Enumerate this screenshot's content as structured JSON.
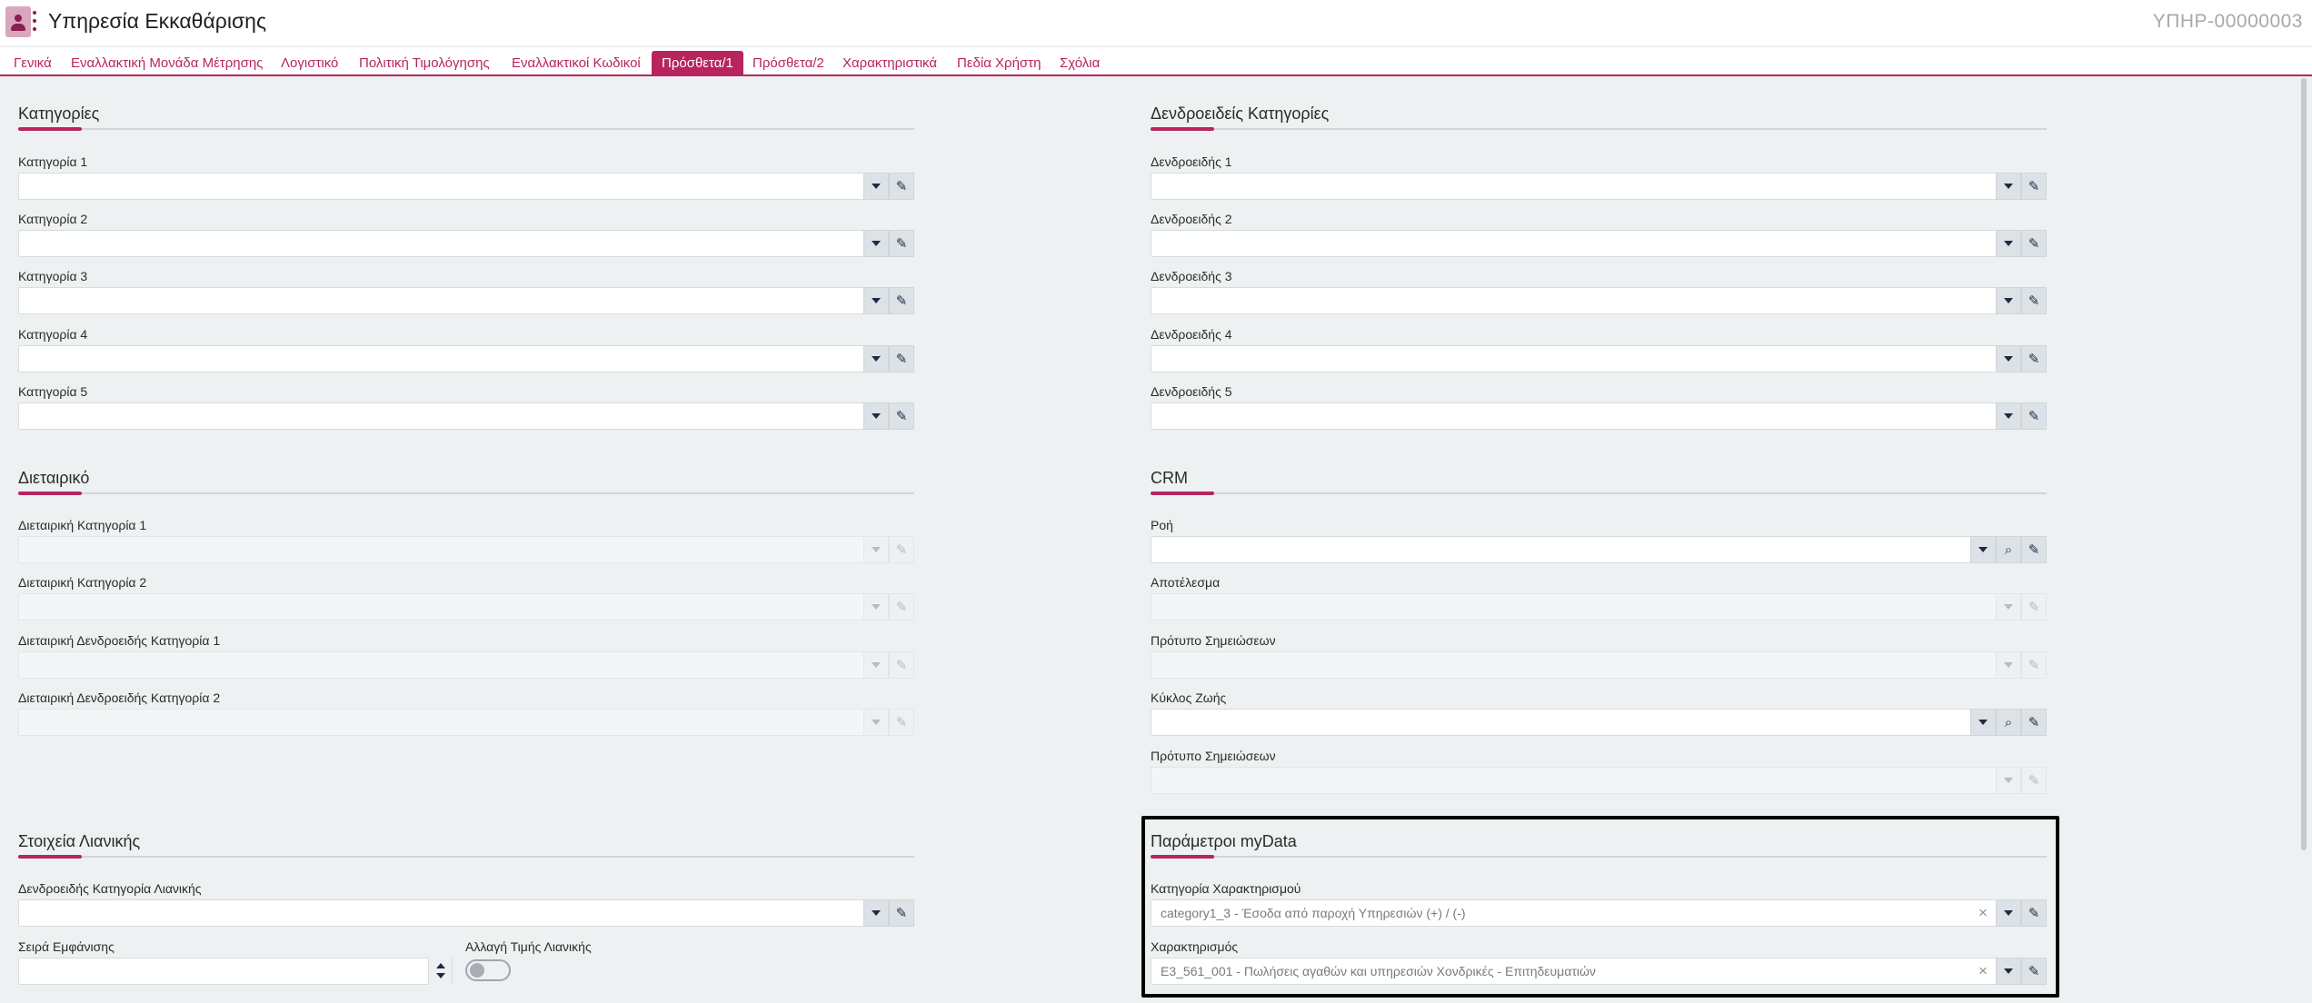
{
  "header": {
    "title": "Υπηρεσία Εκκαθάρισης",
    "record_code": "ΥΠΗΡ-00000003"
  },
  "tabs": [
    {
      "label": "Γενικά",
      "active": false
    },
    {
      "label": "Εναλλακτική Μονάδα Μέτρησης",
      "active": false
    },
    {
      "label": "Λογιστικό",
      "active": false
    },
    {
      "label": "Πολιτική Τιμολόγησης",
      "active": false
    },
    {
      "label": "Εναλλακτικοί Κωδικοί",
      "active": false
    },
    {
      "label": "Πρόσθετα/1",
      "active": true
    },
    {
      "label": "Πρόσθετα/2",
      "active": false
    },
    {
      "label": "Χαρακτηριστικά",
      "active": false
    },
    {
      "label": "Πεδία Χρήστη",
      "active": false
    },
    {
      "label": "Σχόλια",
      "active": false
    }
  ],
  "categories": {
    "title": "Κατηγορίες",
    "fields": [
      {
        "label": "Κατηγορία 1",
        "value": ""
      },
      {
        "label": "Κατηγορία 2",
        "value": ""
      },
      {
        "label": "Κατηγορία 3",
        "value": ""
      },
      {
        "label": "Κατηγορία 4",
        "value": ""
      },
      {
        "label": "Κατηγορία 5",
        "value": ""
      }
    ]
  },
  "tree_categories": {
    "title": "Δενδροειδείς Κατηγορίες",
    "fields": [
      {
        "label": "Δενδροειδής 1",
        "value": ""
      },
      {
        "label": "Δενδροειδής 2",
        "value": ""
      },
      {
        "label": "Δενδροειδής 3",
        "value": ""
      },
      {
        "label": "Δενδροειδής 4",
        "value": ""
      },
      {
        "label": "Δενδροειδής 5",
        "value": ""
      }
    ]
  },
  "dietary": {
    "title": "Διεταιρικό",
    "fields": [
      {
        "label": "Διεταιρική Κατηγορία 1",
        "value": ""
      },
      {
        "label": "Διεταιρική Κατηγορία 2",
        "value": ""
      },
      {
        "label": "Διεταιρική Δενδροειδής Κατηγορία 1",
        "value": ""
      },
      {
        "label": "Διεταιρική Δενδροειδής Κατηγορία 2",
        "value": ""
      }
    ]
  },
  "crm": {
    "title": "CRM",
    "fields": [
      {
        "label": "Ροή",
        "value": ""
      },
      {
        "label": "Αποτέλεσμα",
        "value": ""
      },
      {
        "label": "Πρότυπο Σημειώσεων",
        "value": ""
      },
      {
        "label": "Κύκλος Ζωής",
        "value": ""
      },
      {
        "label": "Πρότυπο Σημειώσεων",
        "value": ""
      }
    ]
  },
  "retail": {
    "title": "Στοιχεία Λιανικής",
    "tree_category_label": "Δενδροειδής Κατηγορία Λιανικής",
    "display_order_label": "Σειρά Εμφάνισης",
    "price_change_label": "Αλλαγή Τιμής Λιανικής",
    "price_change_enabled": false
  },
  "mydata": {
    "title": "Παράμετροι myData",
    "category_label": "Κατηγορία Χαρακτηρισμού",
    "category_value": "category1_3 - Έσοδα από παροχή Υπηρεσιών (+) / (-)",
    "characterization_label": "Χαρακτηρισμός",
    "characterization_value": "E3_561_001 - Πωλήσεις αγαθών και υπηρεσιών Χονδρικές - Επιτηδευματιών"
  },
  "colors": {
    "accent": "#b9245f",
    "background": "#eef1f2"
  }
}
